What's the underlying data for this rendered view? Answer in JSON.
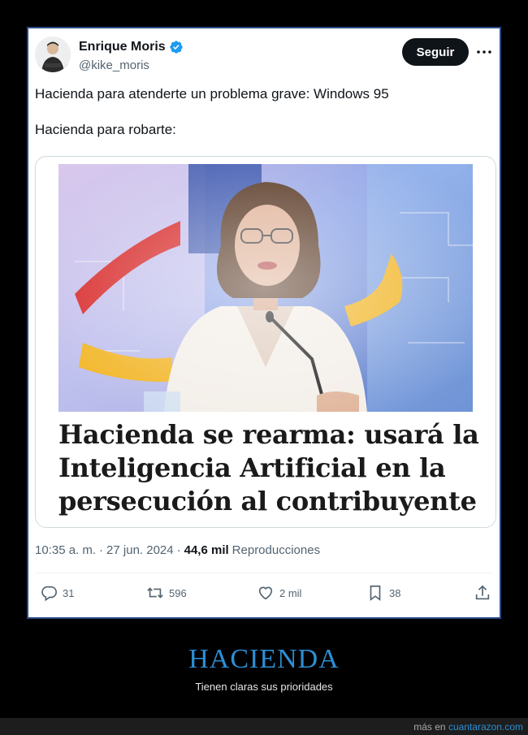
{
  "tweet": {
    "author": {
      "display_name": "Enrique Moris",
      "handle": "@kike_moris",
      "verified": true
    },
    "follow_label": "Seguir",
    "text_lines": [
      "Hacienda para atenderte un problema grave: Windows 95",
      "Hacienda para robarte:"
    ],
    "media": {
      "headline_lines": [
        "Hacienda se rearma: usará la",
        "Inteligencia Artificial en la",
        "persecución al contribuyente"
      ]
    },
    "meta": {
      "time": "10:35 a. m.",
      "sep1": "·",
      "date": "27 jun. 2024",
      "sep2": "·",
      "views_count": "44,6 mil",
      "views_label": "Reproducciones"
    },
    "actions": {
      "replies": "31",
      "retweets": "596",
      "likes": "2 mil",
      "bookmarks": "38"
    }
  },
  "caption": {
    "title": "HACIENDA",
    "subtitle": "Tienen claras sus prioridades"
  },
  "footer": {
    "prefix": "más en",
    "site": "cuantarazon.com"
  },
  "colors": {
    "accent": "#2d8fd5",
    "verified": "#1d9bf0",
    "follow_bg": "#0f1419",
    "frame_border": "#2a4a8a"
  },
  "icons": [
    "verified-badge-icon",
    "more-icon",
    "reply-icon",
    "retweet-icon",
    "like-icon",
    "bookmark-icon",
    "share-icon"
  ]
}
